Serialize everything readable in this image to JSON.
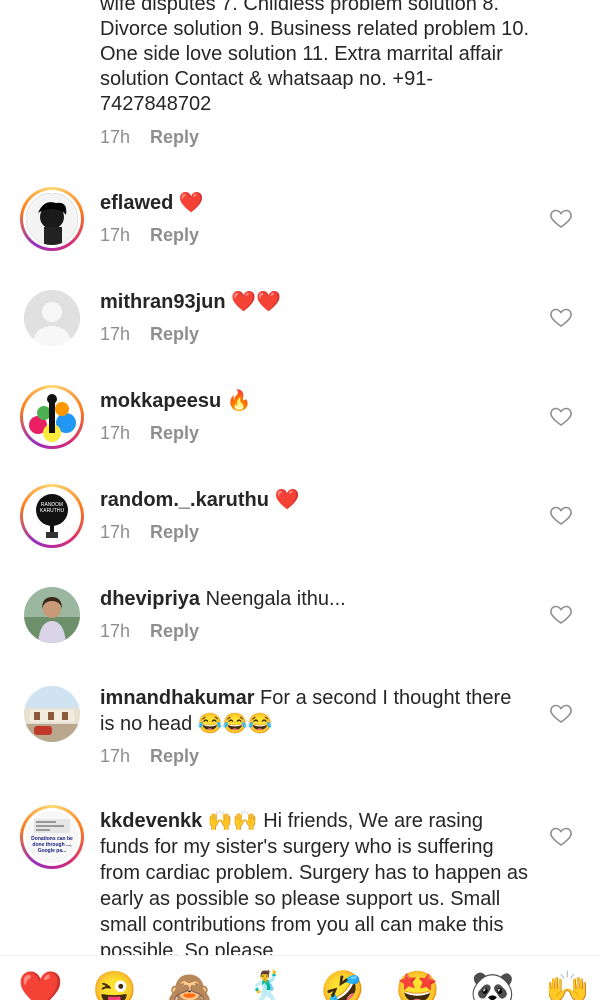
{
  "comments": [
    {
      "text": "wife disputes 7. Childless problem solution 8. Divorce solution 9. Business related problem 10. One side love solution 11. Extra marrital affair solution Contact & whatsaap no. +91-7427848702",
      "time": "17h",
      "reply": "Reply"
    },
    {
      "username": "eflawed",
      "text": "❤️",
      "time": "17h",
      "reply": "Reply"
    },
    {
      "username": "mithran93jun",
      "text": "❤️❤️",
      "time": "17h",
      "reply": "Reply"
    },
    {
      "username": "mokkapeesu",
      "text": "🔥",
      "time": "17h",
      "reply": "Reply"
    },
    {
      "username": "random._.karuthu",
      "text": "❤️",
      "time": "17h",
      "reply": "Reply",
      "avatar_text": "RANDOM KARUTHU"
    },
    {
      "username": "dhevipriya",
      "text": "Neengala ithu...",
      "time": "17h",
      "reply": "Reply"
    },
    {
      "username": "imnandhakumar",
      "text": "For a second I thought there is no head 😂😂😂",
      "time": "17h",
      "reply": "Reply"
    },
    {
      "username": "kkdevenkk",
      "text": "🙌🙌 Hi friends, We are rasing funds for my sister's surgery who is suffering from cardiac problem. Surgery has to happen as early as possible so please support us. Small small contributions from you all can make this possible. So please",
      "avatar_text": "Donations can be done through ..., Google pa..."
    }
  ],
  "emoji_bar": [
    "❤️",
    "😜",
    "🙈",
    "🕺",
    "🤣",
    "🤩",
    "🐼",
    "🙌"
  ],
  "colors": {
    "like_outline": "#8e8e8e",
    "meta": "#8e8e8e",
    "text": "#262626"
  }
}
